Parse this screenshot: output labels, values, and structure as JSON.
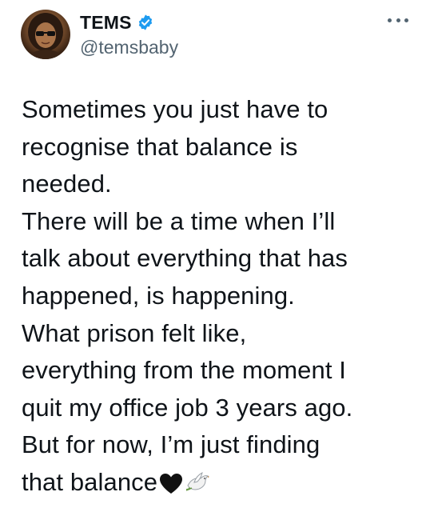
{
  "tweet": {
    "display_name": "TEMS",
    "handle": "@temsbaby",
    "verified": true,
    "more_icon": "more-horizontal-icon",
    "lines": [
      "Sometimes you just have to",
      "recognise that balance is",
      "needed.",
      "There will be a time when I’ll",
      "talk about everything that has",
      "happened, is happening.",
      "What prison felt like,",
      "everything from the moment I",
      "quit my office job 3 years ago.",
      "But for now, I’m just finding",
      "that balance"
    ],
    "trailing_emojis": [
      "black-heart-icon",
      "dove-icon"
    ]
  },
  "colors": {
    "text": "#0f1419",
    "secondary": "#536471",
    "verified": "#1d9bf0"
  }
}
